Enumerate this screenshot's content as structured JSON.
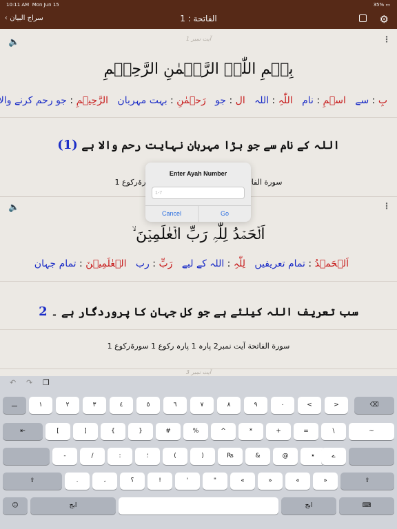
{
  "status_bar": {
    "time": "10:11 AM",
    "date": "Mon Jun 15",
    "battery": "35%"
  },
  "nav": {
    "back_label": "سراج البیان",
    "title": "الفاتحة : 1"
  },
  "ayahs": [
    {
      "number_label": "آیت نمبر 1",
      "arabic": "بِسۡمِ اللّٰہِ الرَّحۡمٰنِ الرَّحِیۡمِ",
      "wbw": [
        {
          "ar": "بِ",
          "ur": "سے"
        },
        {
          "ar": "اسۡمِ",
          "ur": "نام"
        },
        {
          "ar": "اللّٰہِ",
          "ur": "اللہ"
        },
        {
          "ar": "ال",
          "ur": "جو"
        },
        {
          "ar": "رَحۡمٰنِ",
          "ur": "بہت مہربان"
        },
        {
          "ar": "الرَّحِیۡمِ",
          "ur": "جو رحم کرنے والا"
        }
      ],
      "translation": "اللہ کے نام سے جو بڑا مہربان نہایت رحم والا ہے",
      "translation_num": "(1)",
      "reference": "سورة الفاتحة آیت نمبر1 پارہ 1 رکوع 1 سورۃرکوع 1"
    },
    {
      "number_label": "آیت نمبر 2",
      "arabic": "اَلۡحَمۡدُ لِلّٰہِ رَبِّ الۡعٰلَمِیۡنَ ۙ",
      "wbw": [
        {
          "ar": "اَلۡحَمۡدُ",
          "ur": "تمام تعریفیں"
        },
        {
          "ar": "لِلّٰہِ",
          "ur": "اللہ کے لیے"
        },
        {
          "ar": "رَبِّ",
          "ur": "رب"
        },
        {
          "ar": "الۡعٰلَمِیۡنَ",
          "ur": "تمام جہان"
        }
      ],
      "translation": "سب تعریف اللہ کیلئے ہے جو کل جہان کا پروردگار ہے ۔",
      "translation_num": "2",
      "reference": "سورة الفاتحة آیت نمبر2  پارہ 1 پارہ رکوع 1 سورۃرکوع 1"
    }
  ],
  "ayah3_label": "آیت نمبر 3",
  "dialog": {
    "title": "Enter Ayah Number",
    "placeholder": "1-7",
    "cancel": "Cancel",
    "go": "Go"
  },
  "keyboard": {
    "row1": [
      "ـــ",
      "١",
      "٢",
      "٣",
      "٤",
      "٥",
      "٦",
      "٧",
      "٨",
      "٩",
      "٠",
      "<",
      ">"
    ],
    "row2": [
      "[",
      "]",
      "{",
      "}",
      "#",
      "%",
      "^",
      "*",
      "+",
      "=",
      "\\",
      "~"
    ],
    "row3": [
      "-",
      "/",
      ":",
      "؛",
      "(",
      ")",
      "₨",
      "&",
      "@",
      "٭",
      "ے"
    ],
    "row4": [
      ".",
      "،",
      "؟",
      "!",
      "'",
      "\"",
      "«",
      "»"
    ],
    "mode_label": "ابج"
  }
}
